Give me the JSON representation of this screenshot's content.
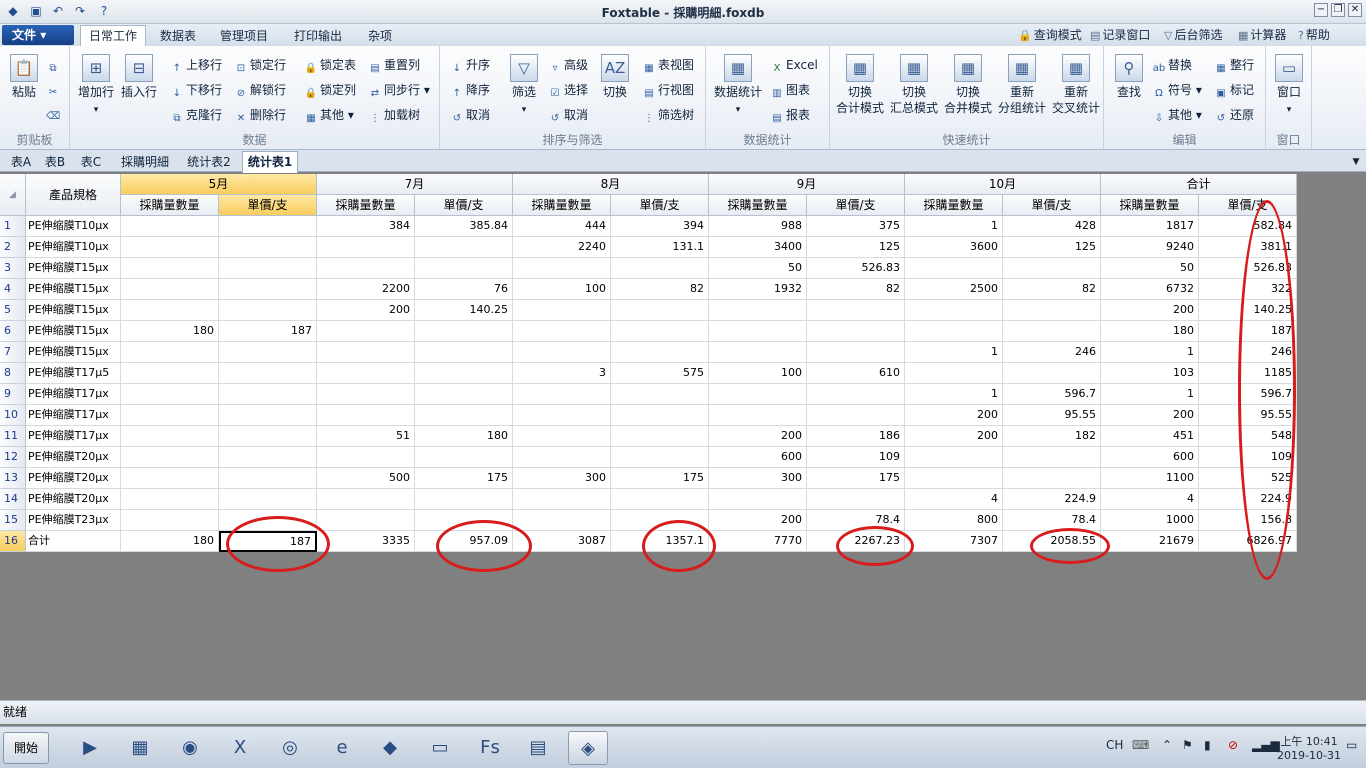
{
  "titlebar": {
    "title": "Foxtable - 採購明細.foxdb",
    "min": "−",
    "restore": "❐",
    "close": "✕"
  },
  "ribbon_tabs": {
    "file": "文件",
    "tabs": [
      "日常工作",
      "数据表",
      "管理项目",
      "打印输出",
      "杂项"
    ]
  },
  "ribbon_right": [
    {
      "label": "查询模式",
      "icon": "lock-icon"
    },
    {
      "label": "记录窗口",
      "icon": "window-icon"
    },
    {
      "label": "后台筛选",
      "icon": "filter-icon"
    },
    {
      "label": "计算器",
      "icon": "calculator-icon"
    },
    {
      "label": "帮助",
      "icon": "help-icon"
    }
  ],
  "ribbon_groups": {
    "clipboard": {
      "label": "剪贴板",
      "paste": "粘贴"
    },
    "data": {
      "label": "数据",
      "add_row": "增加行",
      "insert_row": "插入行",
      "move_up": "上移行",
      "move_down": "下移行",
      "clone_row": "克隆行",
      "lock_row": "锁定行",
      "unlock_row": "解锁行",
      "delete_row": "删除行",
      "lock_table": "锁定表",
      "lock_col": "锁定列",
      "other": "其他",
      "reset_col": "重置列",
      "sync_row": "同步行",
      "load_tree": "加载树"
    },
    "sort_filter": {
      "label": "排序与筛选",
      "asc": "升序",
      "desc": "降序",
      "cancel": "取消",
      "filter": "筛选",
      "advanced": "高级",
      "select": "选择",
      "cancel2": "取消",
      "switch": "切换",
      "table_view": "表视图",
      "row_view": "行视图",
      "filter_tree": "筛选树"
    },
    "data_stats": {
      "label": "数据统计",
      "stats": "数据统计",
      "excel": "Excel",
      "chart": "图表",
      "report": "报表"
    },
    "quick_stats": {
      "label": "快速统计",
      "b1": "切换\n合计模式",
      "b2": "切换\n汇总模式",
      "b3": "切换\n合并模式",
      "b4": "重新\n分组统计",
      "b5": "重新\n交叉统计"
    },
    "edit": {
      "label": "编辑",
      "find": "查找",
      "replace": "替换",
      "symbol": "符号",
      "other": "其他",
      "tidy": "整行",
      "mark": "标记",
      "restore": "还原"
    },
    "window": {
      "label": "窗口",
      "window": "窗口"
    }
  },
  "sheet_tabs": [
    "表A",
    "表B",
    "表C",
    "採購明細",
    "统计表2",
    "统计表1"
  ],
  "active_sheet": "统计表1",
  "grid": {
    "header_left": "產品規格",
    "months": [
      "5月",
      "7月",
      "8月",
      "9月",
      "10月",
      "合计"
    ],
    "sub_headers": [
      "採購量數量",
      "單價/支"
    ],
    "rows": [
      {
        "n": "1",
        "name": "PE伸缩膜T10μx",
        "v": [
          "",
          "",
          "384",
          "385.84",
          "444",
          "394",
          "988",
          "375",
          "1",
          "428",
          "1817",
          "582.84"
        ]
      },
      {
        "n": "2",
        "name": "PE伸缩膜T10μx",
        "v": [
          "",
          "",
          "",
          "",
          "2240",
          "131.1",
          "3400",
          "125",
          "3600",
          "125",
          "9240",
          "381.1"
        ]
      },
      {
        "n": "3",
        "name": "PE伸缩膜T15μx",
        "v": [
          "",
          "",
          "",
          "",
          "",
          "",
          "50",
          "526.83",
          "",
          "",
          "50",
          "526.83"
        ]
      },
      {
        "n": "4",
        "name": "PE伸缩膜T15μx",
        "v": [
          "",
          "",
          "2200",
          "76",
          "100",
          "82",
          "1932",
          "82",
          "2500",
          "82",
          "6732",
          "322"
        ]
      },
      {
        "n": "5",
        "name": "PE伸缩膜T15μx",
        "v": [
          "",
          "",
          "200",
          "140.25",
          "",
          "",
          "",
          "",
          "",
          "",
          "200",
          "140.25"
        ]
      },
      {
        "n": "6",
        "name": "PE伸缩膜T15μx",
        "v": [
          "180",
          "187",
          "",
          "",
          "",
          "",
          "",
          "",
          "",
          "",
          "180",
          "187"
        ]
      },
      {
        "n": "7",
        "name": "PE伸缩膜T15μx",
        "v": [
          "",
          "",
          "",
          "",
          "",
          "",
          "",
          "",
          "1",
          "246",
          "1",
          "246"
        ]
      },
      {
        "n": "8",
        "name": "PE伸缩膜T17μ5",
        "v": [
          "",
          "",
          "",
          "",
          "3",
          "575",
          "100",
          "610",
          "",
          "",
          "103",
          "1185"
        ]
      },
      {
        "n": "9",
        "name": "PE伸缩膜T17μx",
        "v": [
          "",
          "",
          "",
          "",
          "",
          "",
          "",
          "",
          "1",
          "596.7",
          "1",
          "596.7"
        ]
      },
      {
        "n": "10",
        "name": "PE伸缩膜T17μx",
        "v": [
          "",
          "",
          "",
          "",
          "",
          "",
          "",
          "",
          "200",
          "95.55",
          "200",
          "95.55"
        ]
      },
      {
        "n": "11",
        "name": "PE伸缩膜T17μx",
        "v": [
          "",
          "",
          "51",
          "180",
          "",
          "",
          "200",
          "186",
          "200",
          "182",
          "451",
          "548"
        ]
      },
      {
        "n": "12",
        "name": "PE伸缩膜T20μx",
        "v": [
          "",
          "",
          "",
          "",
          "",
          "",
          "600",
          "109",
          "",
          "",
          "600",
          "109"
        ]
      },
      {
        "n": "13",
        "name": "PE伸缩膜T20μx",
        "v": [
          "",
          "",
          "500",
          "175",
          "300",
          "175",
          "300",
          "175",
          "",
          "",
          "1100",
          "525"
        ]
      },
      {
        "n": "14",
        "name": "PE伸缩膜T20μx",
        "v": [
          "",
          "",
          "",
          "",
          "",
          "",
          "",
          "",
          "4",
          "224.9",
          "4",
          "224.9"
        ]
      },
      {
        "n": "15",
        "name": "PE伸缩膜T23μx",
        "v": [
          "",
          "",
          "",
          "",
          "",
          "",
          "200",
          "78.4",
          "800",
          "78.4",
          "1000",
          "156.8"
        ]
      },
      {
        "n": "16",
        "name": "合计",
        "v": [
          "180",
          "187",
          "3335",
          "957.09",
          "3087",
          "1357.1",
          "7770",
          "2267.23",
          "7307",
          "2058.55",
          "21679",
          "6826.97"
        ]
      }
    ]
  },
  "status": {
    "text": "就绪"
  },
  "taskbar": {
    "start": "開始",
    "apps": [
      {
        "icon": "media-player-icon",
        "glyph": "▶"
      },
      {
        "icon": "film-icon",
        "glyph": "▦"
      },
      {
        "icon": "chrome-icon",
        "glyph": "◉"
      },
      {
        "icon": "excel-icon",
        "glyph": "X"
      },
      {
        "icon": "chat-icon",
        "glyph": "◎"
      },
      {
        "icon": "ie-icon",
        "glyph": "e"
      },
      {
        "icon": "app-icon",
        "glyph": "◆"
      },
      {
        "icon": "folder-icon",
        "glyph": "▭"
      },
      {
        "icon": "fs-icon",
        "glyph": "Fs"
      },
      {
        "icon": "foxtable-designer-icon",
        "glyph": "▤"
      },
      {
        "icon": "foxtable-icon",
        "glyph": "◈"
      }
    ],
    "lang": "CH",
    "time": "上午 10:41",
    "date": "2019-10-31"
  },
  "colors": {
    "annotation": "#d81b1b",
    "selected_header": "#f8cd5c"
  }
}
